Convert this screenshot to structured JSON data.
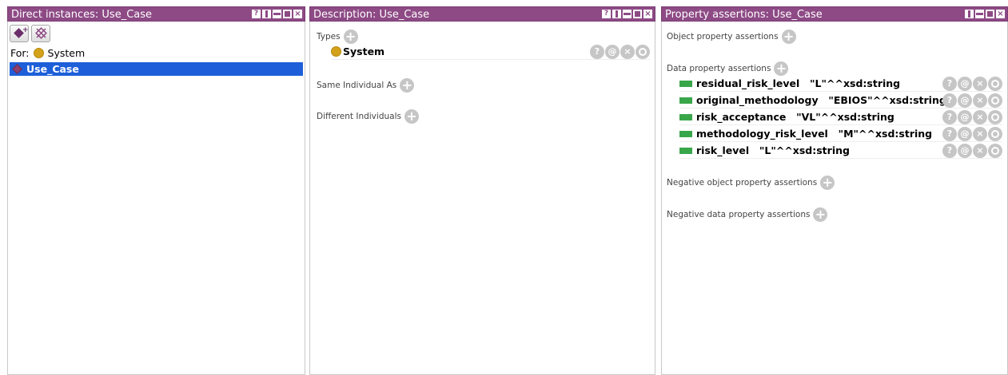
{
  "views": {
    "direct_instances": {
      "title": "Direct instances: Use_Case",
      "for_label": "For:",
      "for_class": "System",
      "instances": [
        "Use_Case"
      ]
    },
    "description": {
      "title": "Description: Use_Case",
      "types_label": "Types",
      "types": [
        "System"
      ],
      "same_individual_label": "Same Individual As",
      "different_individuals_label": "Different Individuals"
    },
    "property_assertions": {
      "title": "Property assertions: Use_Case",
      "object_label": "Object property assertions",
      "data_label": "Data property assertions",
      "data_assertions": [
        {
          "property": "residual_risk_level",
          "value": "\"L\"^^xsd:string"
        },
        {
          "property": "original_methodology",
          "value": "\"EBIOS\"^^xsd:string"
        },
        {
          "property": "risk_acceptance",
          "value": "\"VL\"^^xsd:string"
        },
        {
          "property": "methodology_risk_level",
          "value": "\"M\"^^xsd:string"
        },
        {
          "property": "risk_level",
          "value": "\"L\"^^xsd:string"
        }
      ],
      "negative_object_label": "Negative object property assertions",
      "negative_data_label": "Negative data property assertions"
    }
  },
  "row_buttons": {
    "help": "?",
    "annotate": "@",
    "delete": "×"
  },
  "colors": {
    "title_bar": "#8d4a85",
    "selection": "#1e5fd9",
    "class_icon": "#d3a21b",
    "data_property_icon": "#3aa64a",
    "individual_icon": "#8d3f6d"
  }
}
